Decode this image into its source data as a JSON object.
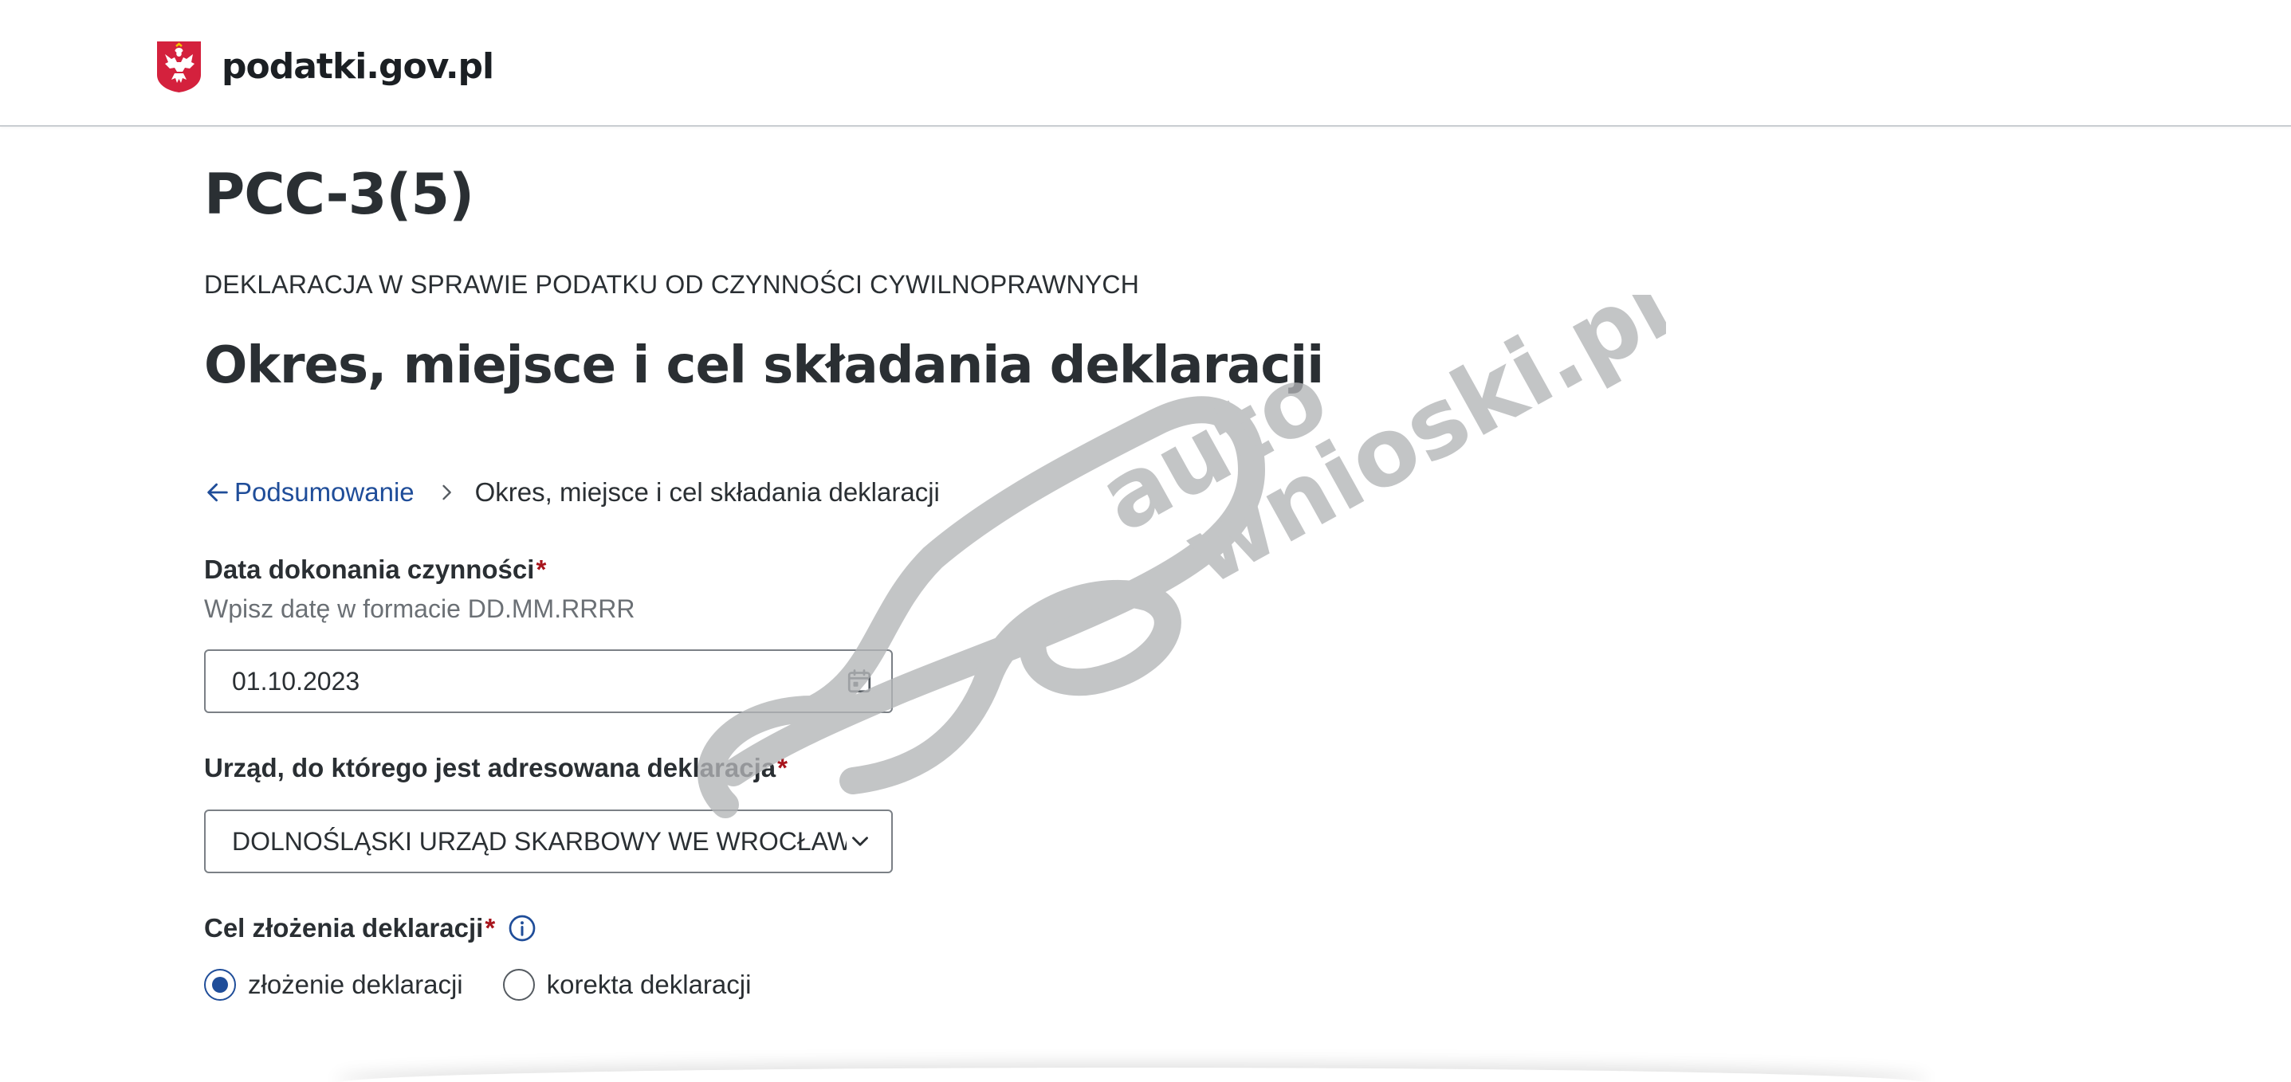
{
  "header": {
    "logo_text": "podatki.gov.pl",
    "logo_emblem": "white-eagle-emblem-icon"
  },
  "form": {
    "code": "PCC-3(5)",
    "subtitle": "DEKLARACJA W SPRAWIE PODATKU OD CZYNNOŚCI CYWILNOPRAWNYCH",
    "section_title": "Okres, miejsce i cel składania deklaracji"
  },
  "breadcrumb": {
    "back_label": "Podsumowanie",
    "current": "Okres, miejsce i cel składania deklaracji"
  },
  "fields": {
    "date": {
      "label": "Data dokonania czynności",
      "required_mark": "*",
      "hint": "Wpisz datę w formacie DD.MM.RRRR",
      "value": "01.10.2023",
      "icon": "calendar-icon"
    },
    "office": {
      "label": "Urząd, do którego jest adresowana deklaracja",
      "required_mark": "*",
      "value": "DOLNOŚLĄSKI URZĄD SKARBOWY WE WROCŁAWIU",
      "icon": "chevron-down-icon"
    },
    "purpose": {
      "label": "Cel złożenia deklaracji",
      "required_mark": "*",
      "info_icon": "info-icon",
      "options": [
        {
          "label": "złożenie deklaracji",
          "selected": true
        },
        {
          "label": "korekta deklaracji",
          "selected": false
        }
      ]
    }
  },
  "watermark": {
    "line1": "auto",
    "line2": "wnioski.pl"
  },
  "colors": {
    "link": "#1f4d99",
    "required": "#a8141c",
    "text": "#2a2f33",
    "hint": "#6b7075",
    "border": "#7b8086",
    "watermark": "#b3b5b7",
    "emblem_red": "#d4213d"
  }
}
